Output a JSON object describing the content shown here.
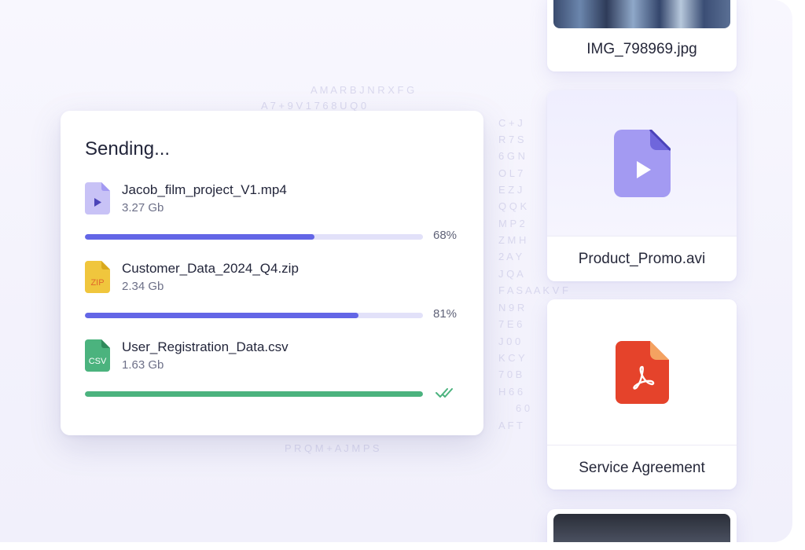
{
  "sending_panel": {
    "title": "Sending...",
    "transfers": [
      {
        "name": "Jacob_film_project_V1.mp4",
        "size": "3.27 Gb",
        "progress": 0.68,
        "percent_label": "68%",
        "icon": "video-file-icon",
        "status": "in-progress"
      },
      {
        "name": "Customer_Data_2024_Q4.zip",
        "size": "2.34 Gb",
        "progress": 0.81,
        "percent_label": "81%",
        "icon": "zip-file-icon",
        "icon_text": "ZIP",
        "status": "in-progress"
      },
      {
        "name": "User_Registration_Data.csv",
        "size": "1.63 Gb",
        "progress": 1.0,
        "percent_label": "",
        "icon": "csv-file-icon",
        "icon_text": "CSV",
        "status": "complete"
      }
    ]
  },
  "file_cards": [
    {
      "name": "IMG_798969.jpg",
      "type": "image",
      "icon": "image-thumbnail"
    },
    {
      "name": "Product_Promo.avi",
      "type": "video",
      "icon": "video-file-icon"
    },
    {
      "name": "Service Agreement",
      "type": "pdf",
      "icon": "pdf-file-icon"
    },
    {
      "name": "",
      "type": "image",
      "icon": "image-thumbnail"
    }
  ],
  "colors": {
    "progress_active": "#6366e6",
    "progress_track": "#e2e1f9",
    "progress_done": "#4bb37e",
    "video_icon": "#a39af2",
    "zip_icon": "#f0c63d",
    "csv_icon": "#4bb37e",
    "pdf_icon": "#e5432b"
  },
  "background_glyphs": [
    "A M A R B J N R X F G",
    "A 7 + 9 V 1 7 6 8 U Q 0",
    "C + J",
    "R 7 S",
    "6 G N",
    "O L 7",
    "E Z J",
    "Q Q K",
    "M P 2",
    "Z M H",
    "2 A Y",
    "J Q A",
    "F A S A A K V F",
    "N 9 R",
    "7 E 6",
    "J 0 0",
    "K C Y",
    "7 0 B",
    "H 6 6",
    "6 0",
    "A F T",
    "P R Q M + A J M P S"
  ]
}
